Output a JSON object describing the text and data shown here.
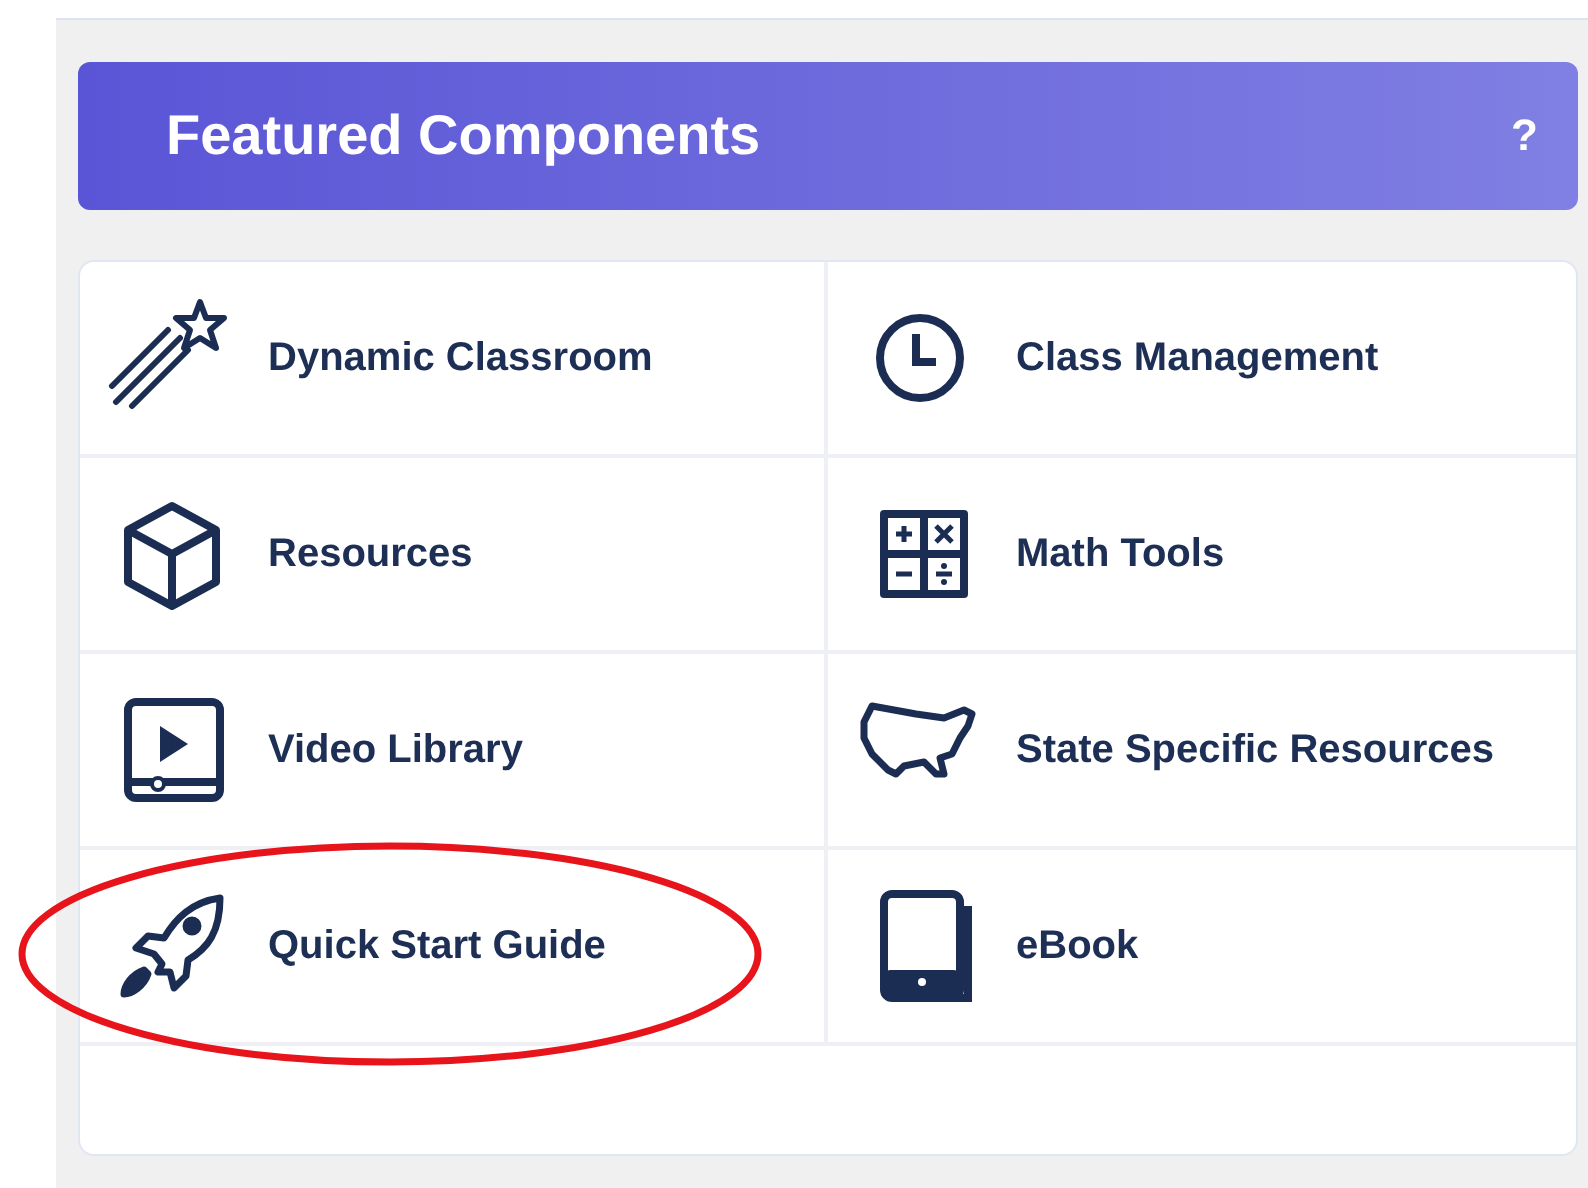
{
  "panel": {
    "title": "Featured Components",
    "help": "?"
  },
  "items": [
    {
      "label": "Dynamic Classroom",
      "highlighted": false
    },
    {
      "label": "Class Management",
      "highlighted": false
    },
    {
      "label": "Resources",
      "highlighted": false
    },
    {
      "label": "Math Tools",
      "highlighted": false
    },
    {
      "label": "Video Library",
      "highlighted": false
    },
    {
      "label": "State Specific Resources",
      "highlighted": false
    },
    {
      "label": "Quick Start Guide",
      "highlighted": true
    },
    {
      "label": "eBook",
      "highlighted": false
    }
  ]
}
